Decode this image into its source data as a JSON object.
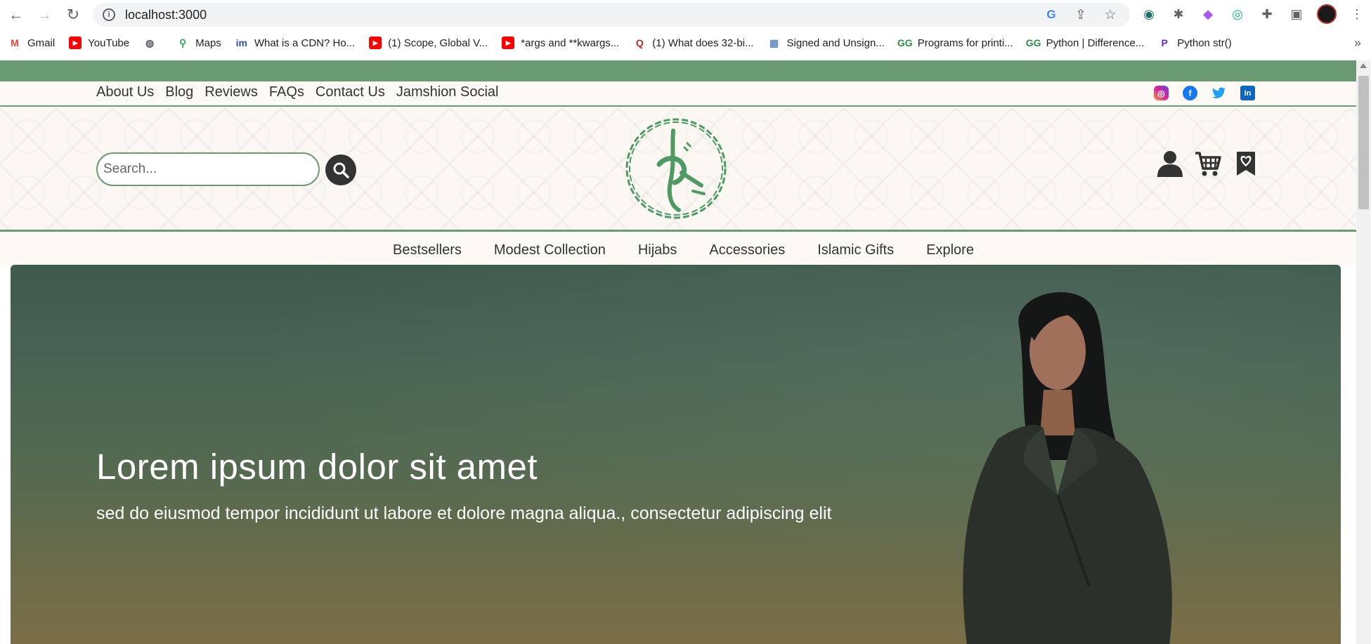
{
  "browser": {
    "url": "localhost:3000",
    "bookmarks": [
      {
        "label": "Gmail",
        "icon": "gmail-icon",
        "color": "#ea4335"
      },
      {
        "label": "YouTube",
        "icon": "youtube-icon",
        "color": "#ff0000"
      },
      {
        "label": "",
        "icon": "globe-icon",
        "color": "#5f6368"
      },
      {
        "label": "Maps",
        "icon": "maps-icon",
        "color": "#34a853"
      },
      {
        "label": "What is a CDN? Ho...",
        "icon": "imperva-icon",
        "color": "#2b4fb8"
      },
      {
        "label": "(1) Scope, Global V...",
        "icon": "youtube-icon",
        "color": "#ff0000"
      },
      {
        "label": "*args and **kwargs...",
        "icon": "youtube-icon",
        "color": "#ff0000"
      },
      {
        "label": "(1) What does 32-bi...",
        "icon": "quora-icon",
        "color": "#b92b27"
      },
      {
        "label": "Signed and Unsign...",
        "icon": "site-icon",
        "color": "#6c8ebf"
      },
      {
        "label": "Programs for printi...",
        "icon": "geeksforgeeks-icon",
        "color": "#2f8d46"
      },
      {
        "label": "Python | Difference...",
        "icon": "geeksforgeeks-icon",
        "color": "#2f8d46"
      },
      {
        "label": "Python str()",
        "icon": "programiz-icon",
        "color": "#6a29d9"
      }
    ],
    "more_label": "»"
  },
  "topbar": {
    "links": [
      "About Us",
      "Blog",
      "Reviews",
      "FAQs",
      "Contact Us",
      "Jamshion Social"
    ],
    "socials": [
      "instagram-icon",
      "facebook-icon",
      "twitter-icon",
      "linkedin-icon"
    ]
  },
  "header": {
    "search_placeholder": "Search..."
  },
  "categories": [
    "Bestsellers",
    "Modest Collection",
    "Hijabs",
    "Accessories",
    "Islamic Gifts",
    "Explore"
  ],
  "hero": {
    "title": "Lorem ipsum dolor sit amet",
    "subtitle": "sed do eiusmod tempor incididunt ut labore et dolore magna aliqua., consectetur adipiscing elit"
  },
  "colors": {
    "brand_green": "#6a9a72",
    "logo_green": "#4e9a62",
    "cream": "#fdfaf6"
  }
}
